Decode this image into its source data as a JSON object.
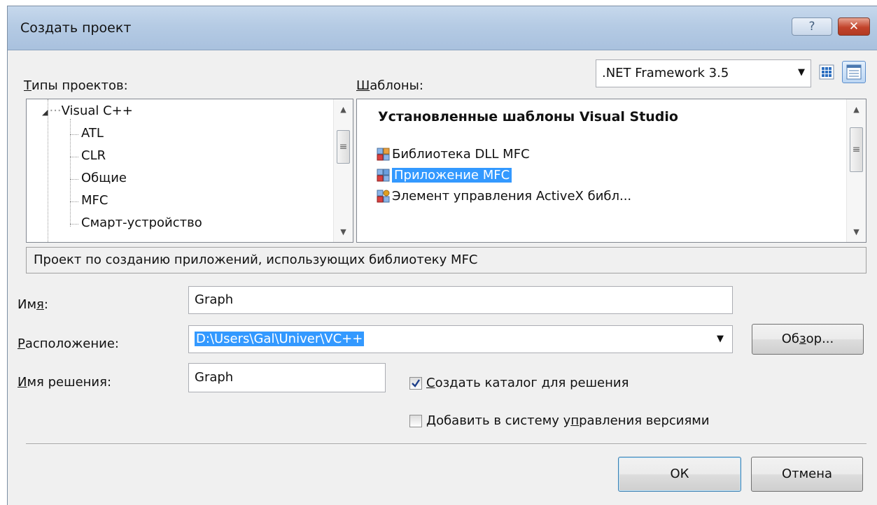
{
  "window": {
    "title": "Создать проект",
    "help_symbol": "?",
    "close_symbol": "✕"
  },
  "project_types": {
    "label_first": "Т",
    "label_rest": "ипы проектов:",
    "tree": {
      "root": "Visual C++",
      "children": [
        "ATL",
        "CLR",
        "Общие",
        "MFC",
        "Смарт-устройство"
      ]
    }
  },
  "templates": {
    "label_first": "Ш",
    "label_rest": "аблоны:",
    "framework": ".NET Framework 3.5",
    "section_header": "Установленные шаблоны Visual Studio",
    "items": [
      "Библиотека DLL MFC",
      "Приложение MFC",
      "Элемент управления  ActiveX библ..."
    ],
    "selected_index": 1
  },
  "description": "Проект по созданию приложений, использующих библиотеку MFC",
  "name": {
    "label_pre": "Им",
    "label_u": "я",
    "label_post": ":",
    "value": "Graph"
  },
  "location": {
    "label_u": "Р",
    "label_post": "асположение:",
    "value": "D:\\Users\\Gal\\Univer\\VC++",
    "browse_pre": "Об",
    "browse_u": "з",
    "browse_post": "ор..."
  },
  "solution_name": {
    "label_u": "И",
    "label_post": "мя решения:",
    "value": "Graph"
  },
  "checkboxes": {
    "create_dir": {
      "checked": true,
      "label_u": "С",
      "label_post": "оздать каталог для решения"
    },
    "add_vcs": {
      "checked": false,
      "label_pre": "Добавить в систему у",
      "label_u": "п",
      "label_post": "равления версиями"
    }
  },
  "buttons": {
    "ok": "ОК",
    "cancel": "Отмена"
  },
  "colors": {
    "selection": "#3399ff",
    "title_bar": "#b5cbe4",
    "close": "#c2432b"
  }
}
